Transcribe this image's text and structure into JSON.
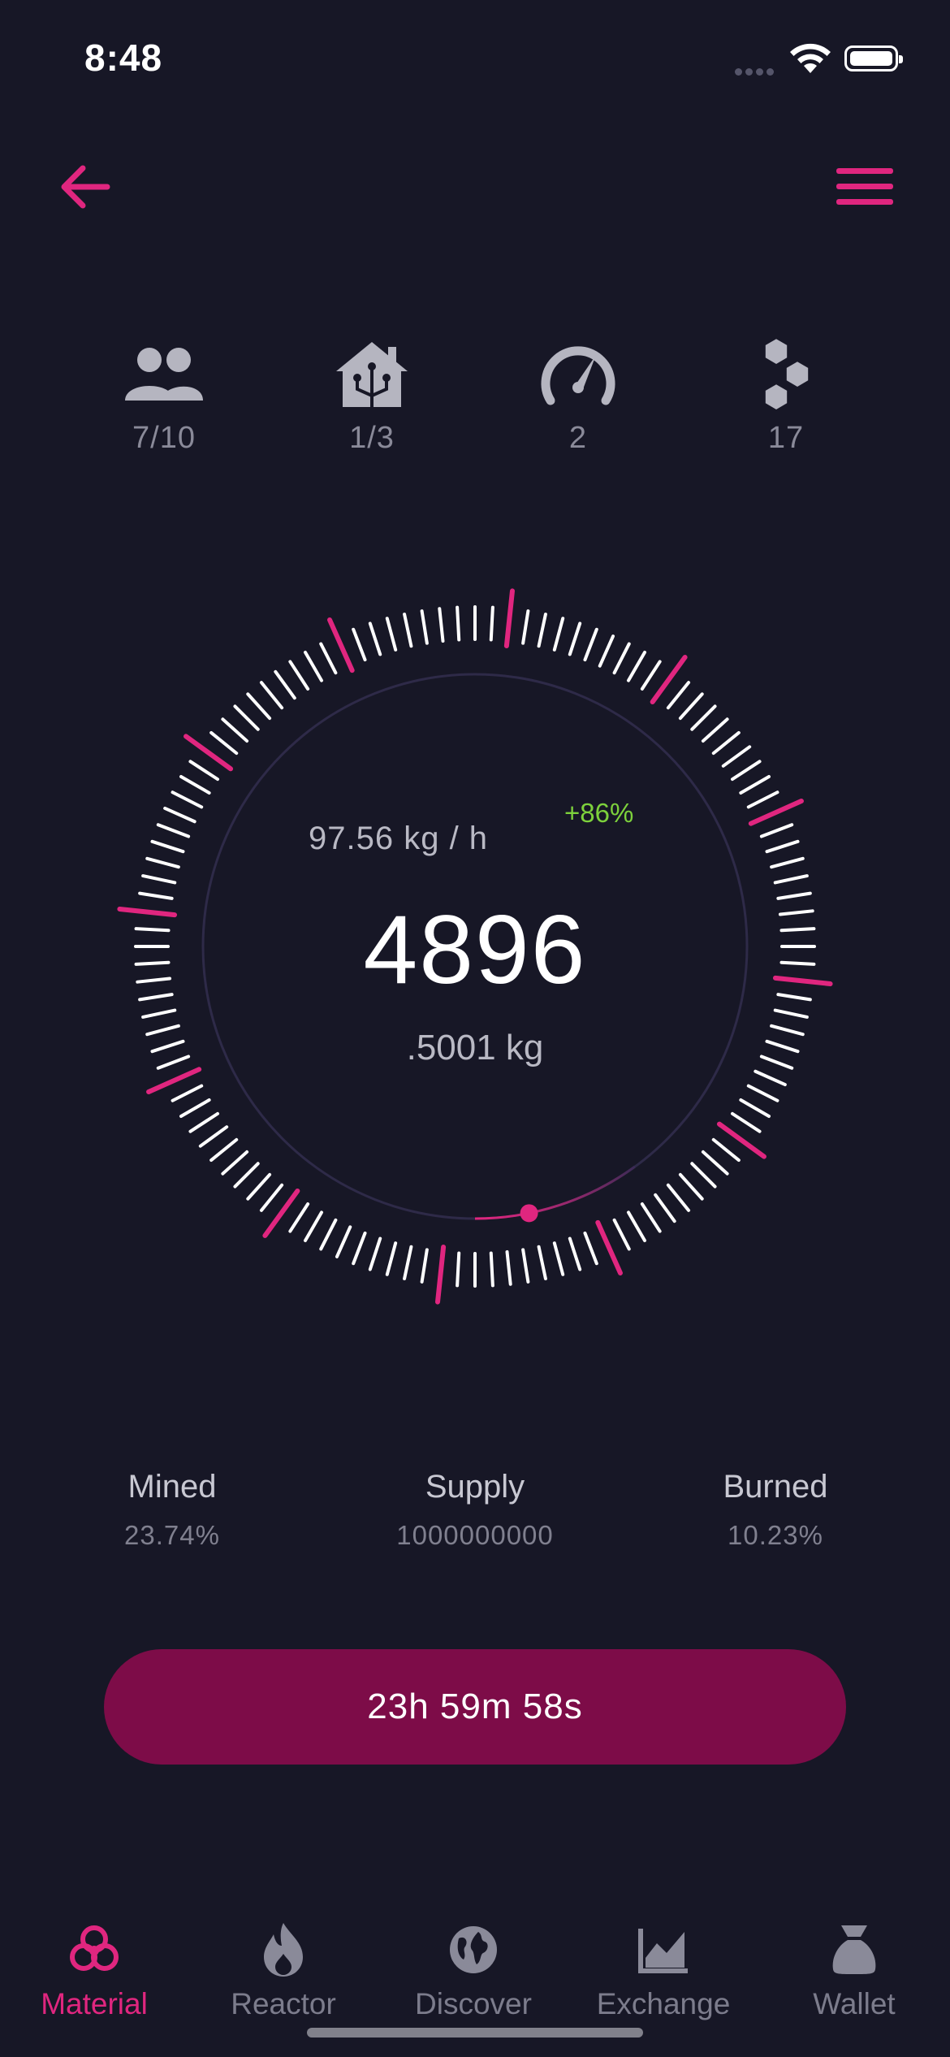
{
  "status_bar": {
    "time": "8:48"
  },
  "stats": [
    {
      "icon": "people-icon",
      "value": "7/10"
    },
    {
      "icon": "smart-home-icon",
      "value": "1/3"
    },
    {
      "icon": "speedometer-icon",
      "value": "2"
    },
    {
      "icon": "hexagons-icon",
      "value": "17"
    }
  ],
  "gauge": {
    "rate": "97.56 kg / h",
    "change": "+86%",
    "value": "4896",
    "sub_value": ".5001 kg",
    "progress": 0.08
  },
  "summary": [
    {
      "label": "Mined",
      "value": "23.74%"
    },
    {
      "label": "Supply",
      "value": "1000000000"
    },
    {
      "label": "Burned",
      "value": "10.23%"
    }
  ],
  "timer": {
    "label": "23h 59m 58s"
  },
  "tabs": [
    {
      "icon": "biohazard-icon",
      "label": "Material",
      "active": true
    },
    {
      "icon": "flame-icon",
      "label": "Reactor",
      "active": false
    },
    {
      "icon": "globe-icon",
      "label": "Discover",
      "active": false
    },
    {
      "icon": "chart-icon",
      "label": "Exchange",
      "active": false
    },
    {
      "icon": "money-bag-icon",
      "label": "Wallet",
      "active": false
    }
  ],
  "colors": {
    "background": "#171726",
    "accent": "#e0267f",
    "button": "#7d0c48",
    "positive": "#7dd13c"
  }
}
